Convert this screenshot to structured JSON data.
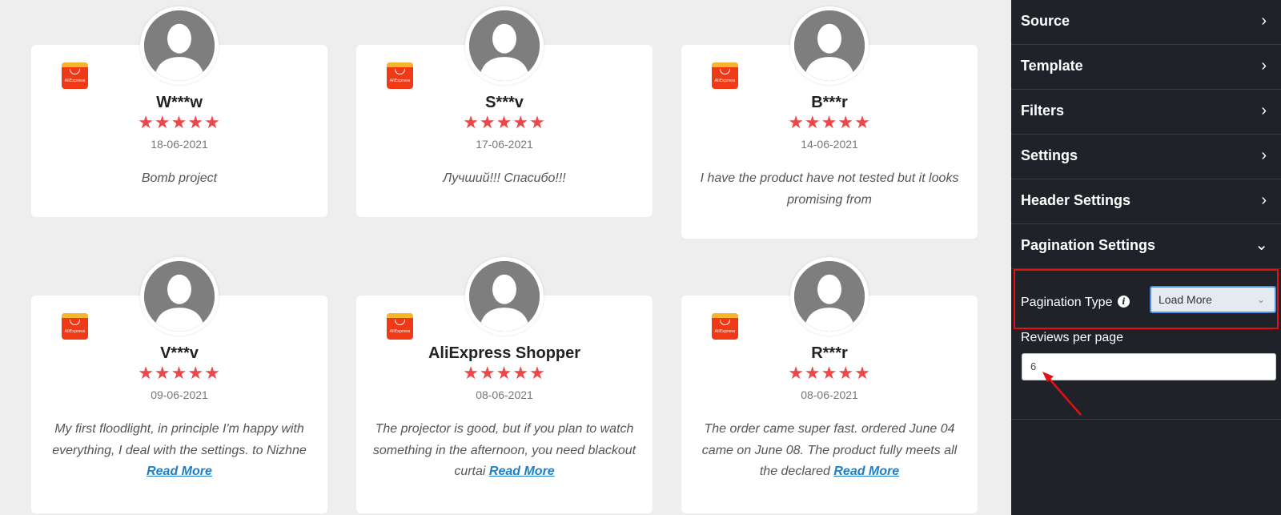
{
  "reviews": [
    {
      "name": "W***w",
      "stars": "★★★★★",
      "rating": 5,
      "date": "18-06-2021",
      "text": "Bomb project",
      "read_more": ""
    },
    {
      "name": "S***v",
      "stars": "★★★★★",
      "rating": 5,
      "date": "17-06-2021",
      "text": "Лучший!!! Спасибо!!!",
      "read_more": ""
    },
    {
      "name": "B***r",
      "stars": "★★★★★",
      "rating": 5,
      "date": "14-06-2021",
      "text": "I have the product have not tested but it looks promising from",
      "read_more": ""
    },
    {
      "name": "V***v",
      "stars": "★★★★★",
      "rating": 5,
      "date": "09-06-2021",
      "text": "My first floodlight, in principle I'm happy with everything, I deal with the settings. to Nizhne",
      "read_more": "Read More"
    },
    {
      "name": "AliExpress Shopper",
      "stars": "★★★★★",
      "rating": 5,
      "date": "08-06-2021",
      "text": "The projector is good, but if you plan to watch something in the afternoon, you need blackout curtai",
      "read_more": "Read More"
    },
    {
      "name": "R***r",
      "stars": "★★★★★",
      "rating": 5,
      "date": "08-06-2021",
      "text": "The order came super fast. ordered June 04 came on June 08. The product fully meets all the declared",
      "read_more": "Read More"
    }
  ],
  "platform": {
    "logo_text": "AliExpress",
    "icon": "aliexpress-logo-icon"
  },
  "sidebar": {
    "sections": [
      {
        "label": "Source",
        "icon": "chevron-right-icon",
        "chev": "›"
      },
      {
        "label": "Template",
        "icon": "chevron-right-icon",
        "chev": "›"
      },
      {
        "label": "Filters",
        "icon": "chevron-right-icon",
        "chev": "›"
      },
      {
        "label": "Settings",
        "icon": "chevron-right-icon",
        "chev": "›"
      },
      {
        "label": "Header Settings",
        "icon": "chevron-right-icon",
        "chev": "›"
      },
      {
        "label": "Pagination Settings",
        "icon": "chevron-down-icon",
        "chev": "⌄"
      }
    ],
    "pagination": {
      "type_label": "Pagination Type",
      "info_glyph": "i",
      "type_value": "Load More",
      "caret": "⌄",
      "per_page_label": "Reviews per page",
      "per_page_value": "6"
    }
  },
  "colors": {
    "star": "#ee4749",
    "link": "#1d7fc8",
    "sidebar_bg": "#1f2329",
    "highlight": "#e31111",
    "aliexpress_red": "#f03a17"
  }
}
